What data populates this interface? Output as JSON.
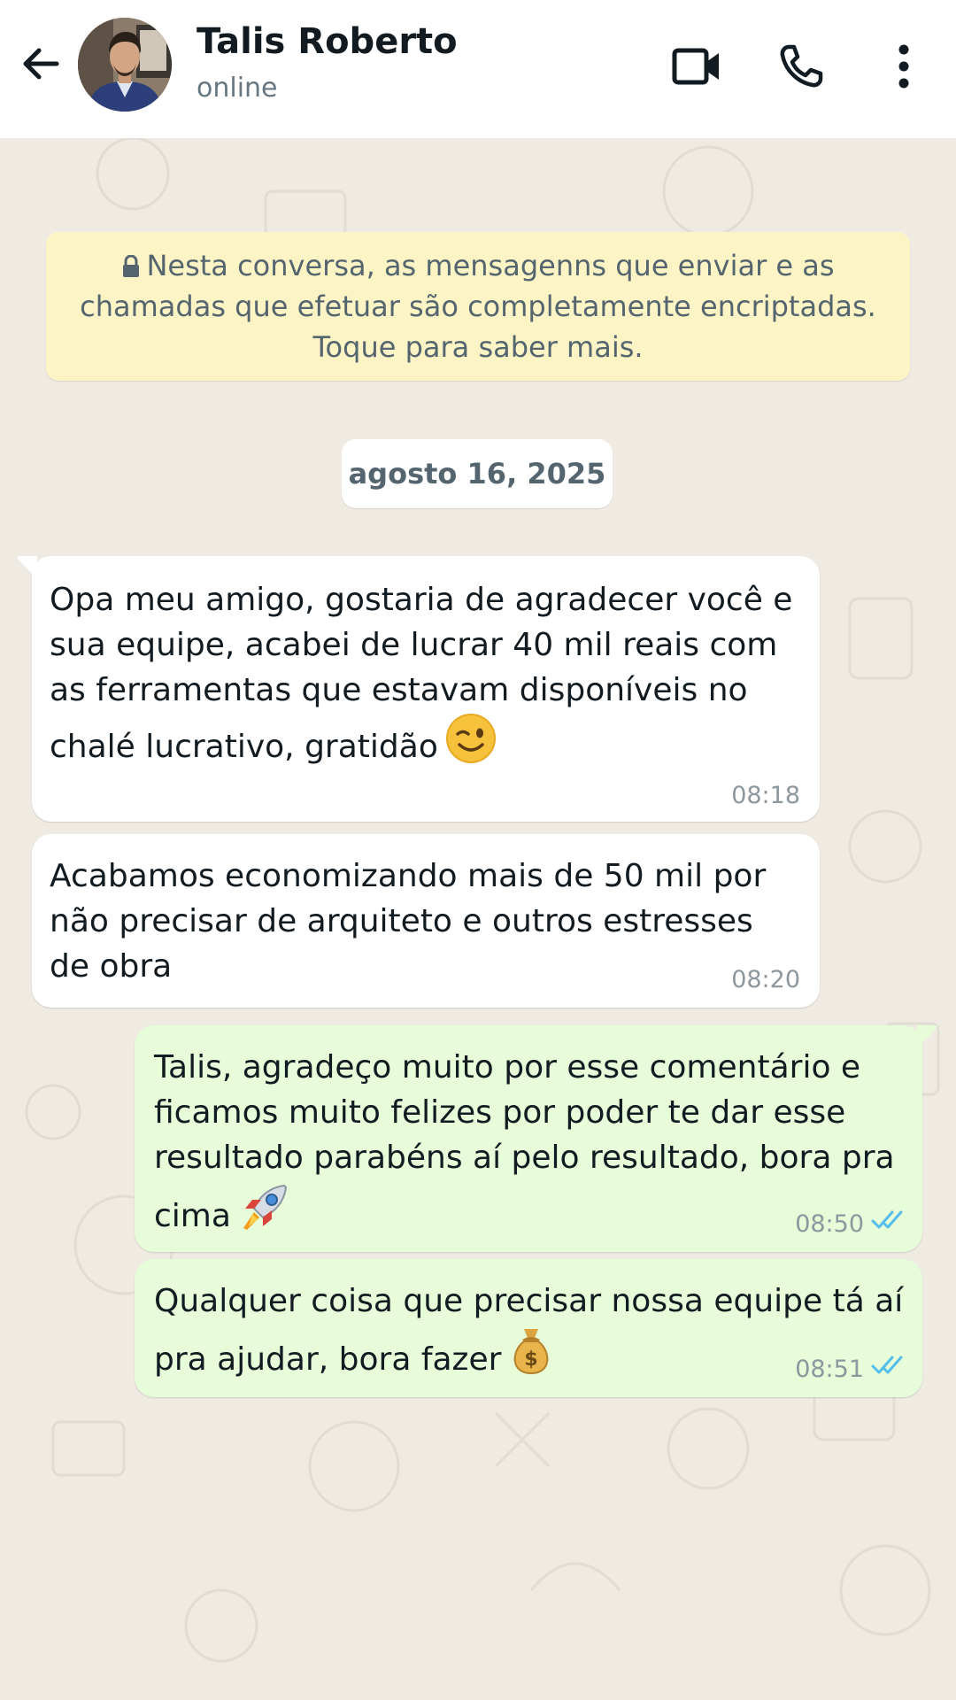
{
  "header": {
    "contact_name": "Talis Roberto",
    "status": "online",
    "icons": [
      "arrow-left-icon",
      "video-camera-icon",
      "phone-icon",
      "more-vertical-icon"
    ]
  },
  "chat": {
    "encryption_notice": "Nesta conversa, as mensagenns que enviar e as chamadas que efetuar são completamente encriptadas. Toque para saber mais.",
    "date_chip": "agosto 16, 2025",
    "messages": [
      {
        "direction": "incoming",
        "text": "Opa meu amigo, gostaria de agradecer você e sua equipe, acabei de lucrar 40 mil reais com as ferramentas que estavam disponíveis no chalé lucrativo, gratidão",
        "emoji": "winking-face-emoji",
        "time": "08:18"
      },
      {
        "direction": "incoming",
        "text": "Acabamos economizando mais de 50 mil por não precisar de arquiteto e outros estresses de obra",
        "time": "08:20"
      },
      {
        "direction": "outgoing",
        "text": "Talis, agradeço muito por esse comentário e ficamos muito felizes por poder te dar esse resultado parabéns aí pelo resultado, bora pra cima",
        "emoji": "rocket-emoji",
        "time": "08:50",
        "status": "read"
      },
      {
        "direction": "outgoing",
        "text": "Qualquer coisa que precisar nossa equipe tá aí pra ajudar, bora fazer",
        "emoji": "money-bag-emoji",
        "time": "08:51",
        "status": "read"
      }
    ]
  },
  "colors": {
    "header_bg": "#ffffff",
    "chat_bg": "#efeae2",
    "incoming_bubble": "#ffffff",
    "outgoing_bubble": "#e7fcd8",
    "notice_bg": "#fdf4c5",
    "read_ticks": "#53bdeb"
  }
}
